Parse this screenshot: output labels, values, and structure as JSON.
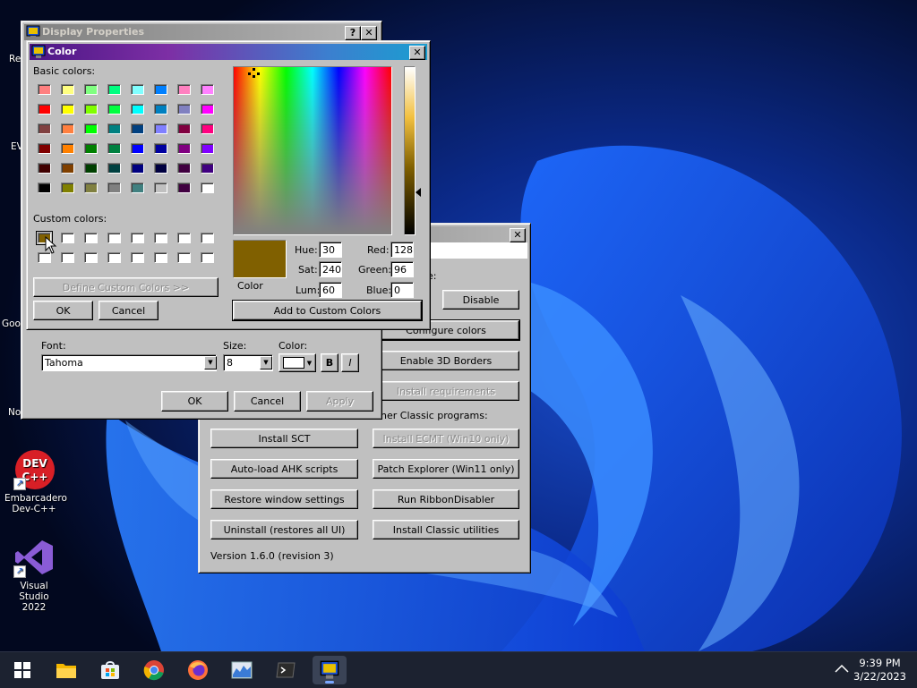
{
  "desktop": {
    "icons": [
      {
        "label": "Embarcadero Dev-C++",
        "line1": "Embarcadero",
        "line2": "Dev-C++",
        "icon": "devcpp-icon"
      },
      {
        "label": "Visual Studio 2022",
        "line1": "Visual Studio",
        "line2": "2022",
        "icon": "visual-studio-icon"
      }
    ],
    "fragments": [
      "Re",
      "EV",
      "Goo",
      "No"
    ]
  },
  "display_properties": {
    "title": "Display Properties",
    "font_label": "Font:",
    "font_value": "Tahoma",
    "size_label": "Size:",
    "size_value": "8",
    "color_label": "Color:",
    "bold_label": "B",
    "italic_label": "I",
    "ok": "OK",
    "cancel": "Cancel",
    "apply": "Apply"
  },
  "color_dialog": {
    "title": "Color",
    "basic_colors_label": "Basic colors:",
    "custom_colors_label": "Custom colors:",
    "define_custom": "Define Custom Colors >>",
    "ok": "OK",
    "cancel": "Cancel",
    "color_solid_label": "Color",
    "hue_label": "Hue:",
    "hue": "30",
    "sat_label": "Sat:",
    "sat": "240",
    "lum_label": "Lum:",
    "lum": "60",
    "red_label": "Red:",
    "red": "128",
    "green_label": "Green:",
    "green": "96",
    "blue_label": "Blue:",
    "blue": "0",
    "add_custom": "Add to Custom Colors",
    "selected_color": "#806000",
    "basic_colors": [
      "#ff8080",
      "#ffff80",
      "#80ff80",
      "#00ff80",
      "#80ffff",
      "#0080ff",
      "#ff80c0",
      "#ff80ff",
      "#ff0000",
      "#ffff00",
      "#80ff00",
      "#00ff40",
      "#00ffff",
      "#0080c0",
      "#8080c0",
      "#ff00ff",
      "#804040",
      "#ff8040",
      "#00ff00",
      "#008080",
      "#004080",
      "#8080ff",
      "#800040",
      "#ff0080",
      "#800000",
      "#ff8000",
      "#008000",
      "#008040",
      "#0000ff",
      "#0000a0",
      "#800080",
      "#8000ff",
      "#400000",
      "#804000",
      "#004000",
      "#004040",
      "#000080",
      "#000040",
      "#400040",
      "#400080",
      "#000000",
      "#808000",
      "#808040",
      "#808080",
      "#408080",
      "#c0c0c0",
      "#400040",
      "#ffffff"
    ],
    "custom_colors": [
      "#806000",
      "#ffffff",
      "#ffffff",
      "#ffffff",
      "#ffffff",
      "#ffffff",
      "#ffffff",
      "#ffffff",
      "#ffffff",
      "#ffffff",
      "#ffffff",
      "#ffffff",
      "#ffffff",
      "#ffffff",
      "#ffffff",
      "#ffffff"
    ]
  },
  "classic_tool": {
    "partial_label": "e:",
    "disable": "Disable",
    "configure_colors": "Configure colors",
    "enable_3d": "Enable 3D Borders",
    "install_requirements": "Install requirements",
    "other_programs": "her Classic programs:",
    "install_sct": "Install SCT",
    "install_ecmt": "Install ECMT (Win10 only)",
    "autoload_ahk": "Auto-load AHK scripts",
    "patch_explorer": "Patch Explorer (Win11 only)",
    "restore_window": "Restore window settings",
    "run_ribbon": "Run RibbonDisabler",
    "uninstall": "Uninstall (restores all UI)",
    "install_utilities": "Install Classic utilities",
    "version": "Version 1.6.0 (revision 3)"
  },
  "taskbar": {
    "time": "9:39 PM",
    "date": "3/22/2023",
    "apps": [
      "start-icon",
      "file-explorer-icon",
      "store-icon",
      "chrome-icon",
      "firefox-icon",
      "task-manager-icon",
      "terminal-icon",
      "display-properties-icon"
    ]
  }
}
